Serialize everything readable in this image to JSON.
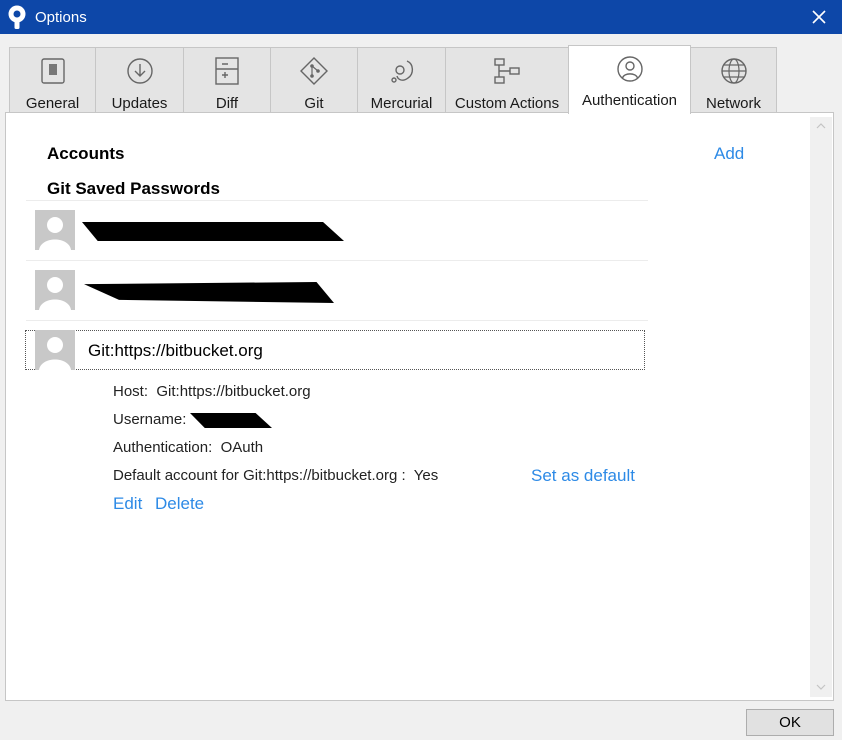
{
  "window": {
    "title": "Options",
    "icon": "sourcetree-icon",
    "titlebar_color": "#0d47a8"
  },
  "tabs": [
    {
      "label": "General",
      "icon": "switch-icon"
    },
    {
      "label": "Updates",
      "icon": "download-icon"
    },
    {
      "label": "Diff",
      "icon": "diff-icon"
    },
    {
      "label": "Git",
      "icon": "git-icon"
    },
    {
      "label": "Mercurial",
      "icon": "mercurial-icon"
    },
    {
      "label": "Custom Actions",
      "icon": "custom-actions-icon"
    },
    {
      "label": "Authentication",
      "icon": "user-icon",
      "active": true
    },
    {
      "label": "Network",
      "icon": "globe-icon"
    }
  ],
  "authentication": {
    "accounts_heading": "Accounts",
    "add_label": "Add",
    "saved_passwords_heading": "Git Saved Passwords",
    "accounts": [
      {
        "name": "[redacted]"
      },
      {
        "name": "[redacted]"
      },
      {
        "name": "Git:https://bitbucket.org",
        "selected": true
      }
    ],
    "details": {
      "host_label": "Host:",
      "host_value": "Git:https://bitbucket.org",
      "username_label": "Username:",
      "username_value": "[redacted]",
      "auth_label": "Authentication:",
      "auth_value": "OAuth",
      "default_label": "Default account for Git:https://bitbucket.org :",
      "default_value": "Yes",
      "set_default_label": "Set as default",
      "edit_label": "Edit",
      "delete_label": "Delete"
    }
  },
  "footer": {
    "ok_label": "OK"
  },
  "colors": {
    "link": "#2d8ae6",
    "avatar": "#c8c8c8"
  }
}
